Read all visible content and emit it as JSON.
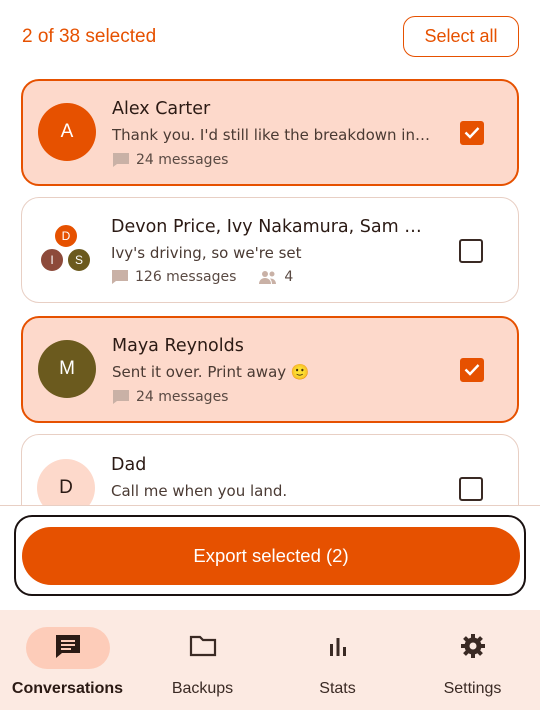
{
  "header": {
    "selection_count": "2 of 38 selected",
    "select_all_label": "Select all"
  },
  "conversations": [
    {
      "initials": "A",
      "name": "Alex Carter",
      "preview": "Thank you. I'd still like the breakdown in writing.",
      "messages": "24 messages",
      "selected": true,
      "avatar_color": "#E65100"
    },
    {
      "initials": [
        "D",
        "I",
        "S"
      ],
      "name": "Devon Price, Ivy Nakamura, Sam Whitfield",
      "preview": "Ivy's driving, so we're set",
      "messages": "126 messages",
      "participants": "4",
      "selected": false,
      "avatar_colors": [
        "#E65100",
        "#8D4A3A",
        "#6B5A1E"
      ]
    },
    {
      "initials": "M",
      "name": "Maya Reynolds",
      "preview": "Sent it over. Print away 🙂",
      "messages": "24 messages",
      "selected": true,
      "avatar_color": "#6B5A1E"
    },
    {
      "initials": "D",
      "name": "Dad",
      "preview": "Call me when you land.",
      "selected": false,
      "avatar_color": "#FDD9CB"
    }
  ],
  "export_button_label": "Export selected (2)",
  "nav": {
    "items": [
      {
        "label": "Conversations",
        "icon": "chat-icon",
        "active": true
      },
      {
        "label": "Backups",
        "icon": "folder-icon",
        "active": false
      },
      {
        "label": "Stats",
        "icon": "bar-chart-icon",
        "active": false
      },
      {
        "label": "Settings",
        "icon": "gear-icon",
        "active": false
      }
    ]
  },
  "colors": {
    "accent": "#E65100",
    "selected_card_bg": "#FDD9CB",
    "nav_bg": "#FCEAE2"
  }
}
